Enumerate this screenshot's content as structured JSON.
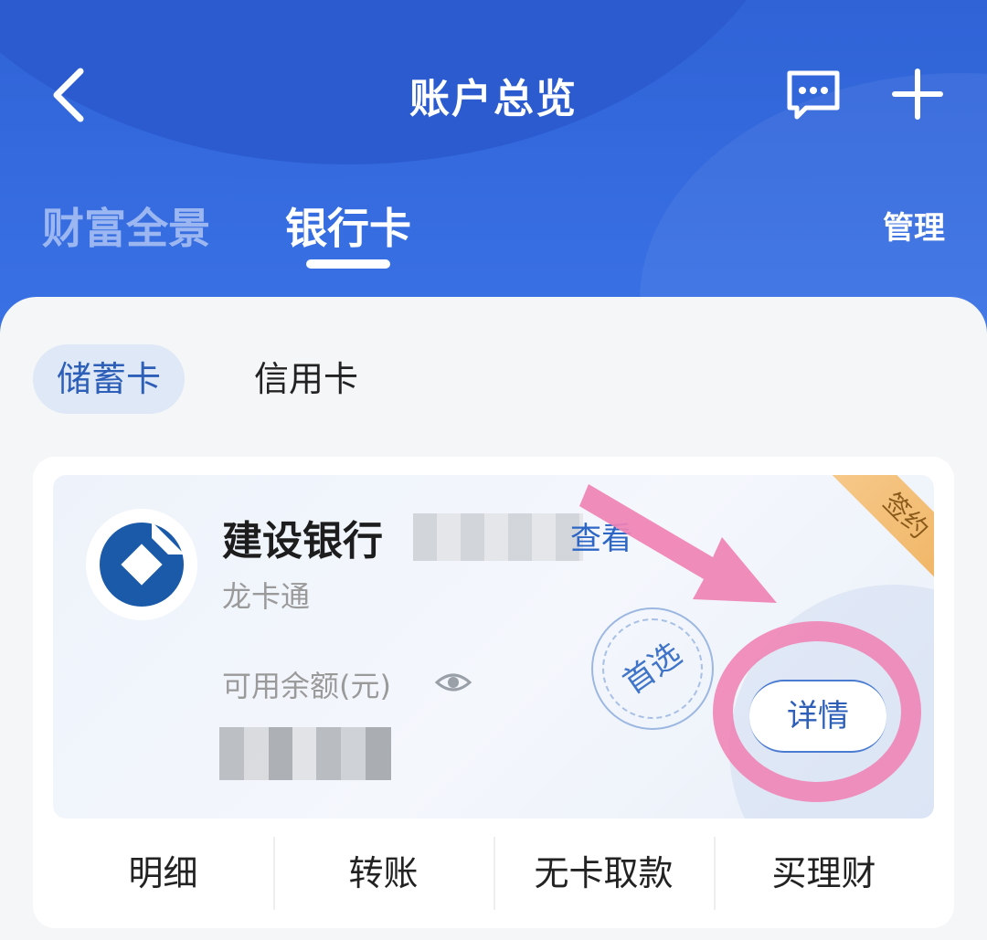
{
  "header": {
    "title": "账户总览",
    "tabs": [
      {
        "label": "财富全景",
        "active": false
      },
      {
        "label": "银行卡",
        "active": true
      }
    ],
    "manage_label": "管理"
  },
  "filters": {
    "debit_label": "储蓄卡",
    "credit_label": "信用卡"
  },
  "card": {
    "bank_name": "建设银行",
    "view_link": "查看",
    "card_type": "龙卡通",
    "sign_badge": "签约",
    "stamp_label": "首选",
    "balance_label": "可用余额(元)",
    "detail_label": "详情",
    "actions": [
      "明细",
      "转账",
      "无卡取款",
      "买理财"
    ]
  },
  "icons": {
    "back": "chevron-left-icon",
    "message": "message-icon",
    "add": "plus-icon",
    "eye": "eye-icon",
    "logo": "ccb-logo-icon"
  },
  "colors": {
    "header_blue": "#2f63d6",
    "accent_blue": "#2d5fb8",
    "highlight_pink": "#f082b4",
    "badge_gold": "#f0b463"
  }
}
